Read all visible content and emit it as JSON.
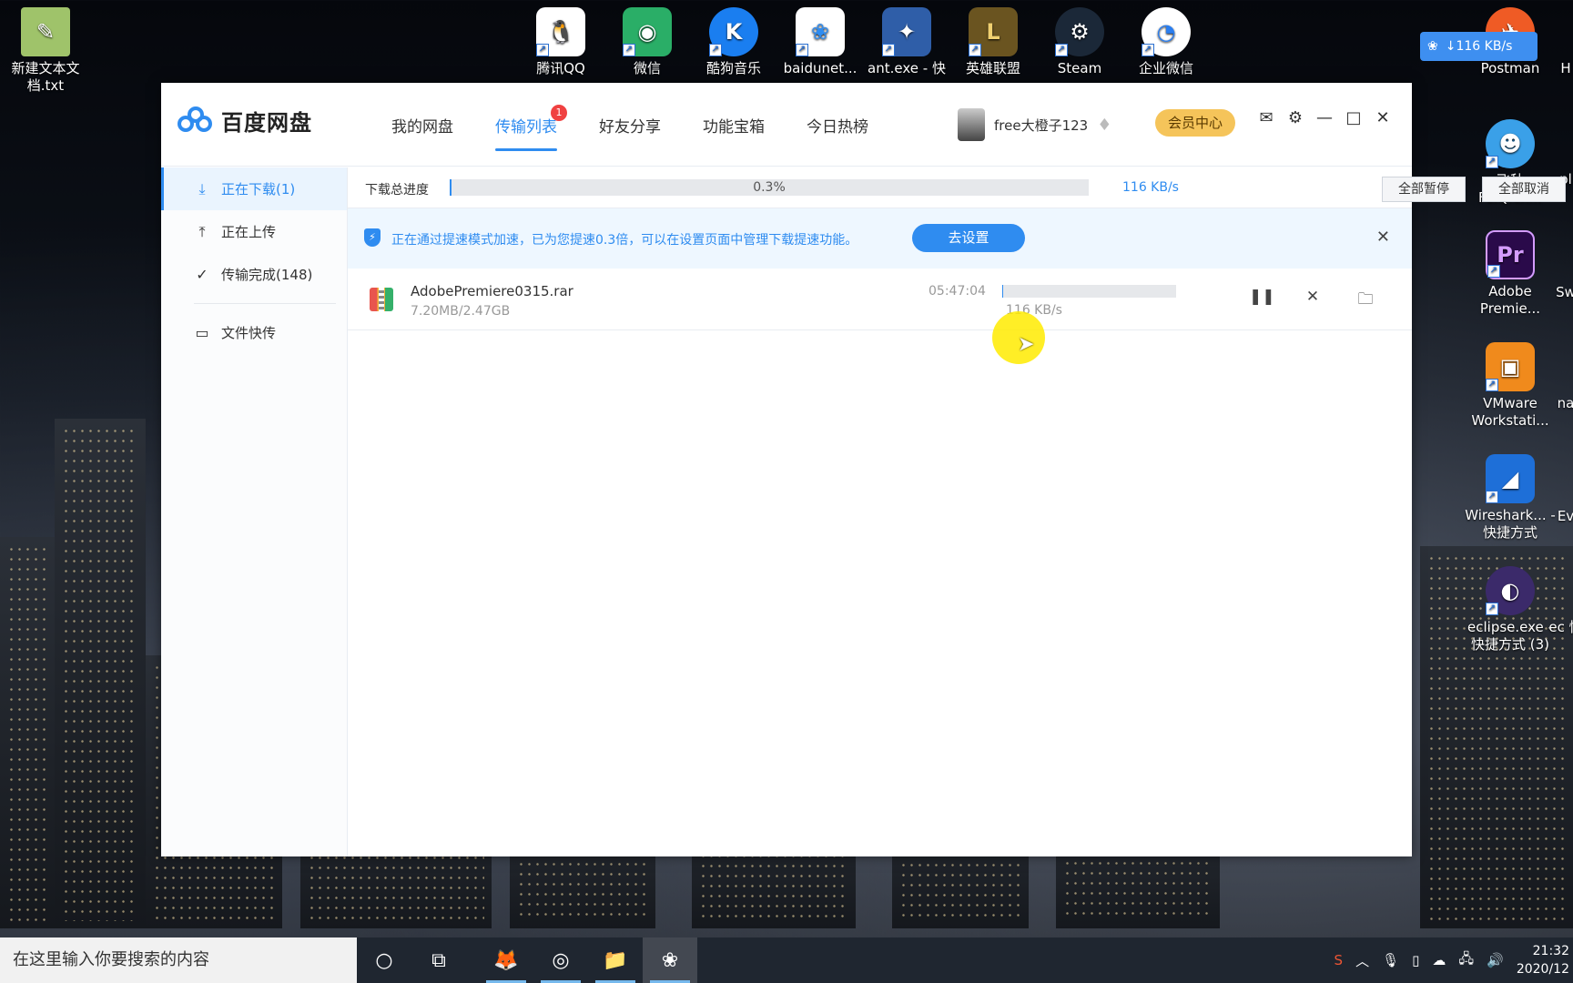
{
  "desktop": {
    "left_icons": [
      {
        "label": "新建文本文档.txt"
      }
    ],
    "top_icons": [
      {
        "label": "腾讯QQ",
        "color": "#1f1f1f"
      },
      {
        "label": "微信",
        "color": "#2aae67"
      },
      {
        "label": "酷狗音乐",
        "color": "#1a7ef0"
      },
      {
        "label": "baidunet...",
        "color": "#ffffff"
      },
      {
        "label": "ant.exe - 快",
        "color": "#2f5ea8"
      },
      {
        "label": "英雄联盟",
        "color": "#c8a24a"
      },
      {
        "label": "Steam",
        "color": "#1b2838"
      },
      {
        "label": "企业微信",
        "color": "#2a7ef0"
      }
    ],
    "right_icons": [
      {
        "label": "Postman",
        "color": "#ef5b25"
      },
      {
        "label": "飞秋 FeiQ.ex...",
        "color": "#3aa0e8"
      },
      {
        "label": "Adobe Premie...",
        "color": "#2a0a4a"
      },
      {
        "label": "VMware Workstati...",
        "color": "#6b7fa0"
      },
      {
        "label": "Wireshark... - 快捷方式",
        "color": "#1e6fd8"
      },
      {
        "label": "eclipse.exe - 快捷方式 (3)",
        "color": "#3b2a6a"
      }
    ],
    "edge_labels": [
      "H",
      "pl",
      "Sw",
      "na",
      "Ev",
      "ec 快"
    ]
  },
  "float_widget": {
    "speed": "↓116 KB/s"
  },
  "app": {
    "title": "百度网盘",
    "tabs": [
      {
        "label": "我的网盘",
        "active": false
      },
      {
        "label": "传输列表",
        "active": true,
        "badge": "1"
      },
      {
        "label": "好友分享",
        "active": false
      },
      {
        "label": "功能宝箱",
        "active": false
      },
      {
        "label": "今日热榜",
        "active": false
      }
    ],
    "username": "free大橙子123",
    "vip_label": "会员中心",
    "sidebar": [
      {
        "label": "正在下载(1)",
        "icon": "download-icon",
        "active": true
      },
      {
        "label": "正在上传",
        "icon": "upload-icon",
        "active": false
      },
      {
        "label": "传输完成(148)",
        "icon": "check-circle-icon",
        "active": false
      },
      {
        "label": "文件快传",
        "icon": "monitor-icon",
        "active": false
      }
    ],
    "total": {
      "label": "下载总进度",
      "percent_text": "0.3%",
      "progress": 0.003,
      "speed": "116 KB/s",
      "pause_all": "全部暂停",
      "cancel_all": "全部取消"
    },
    "notice": {
      "message": "正在通过提速模式加速，已为您提速0.3倍，可以在设置页面中管理下载提速功能。",
      "button": "去设置"
    },
    "downloads": [
      {
        "name": "AdobePremiere0315.rar",
        "size": "7.20MB/2.47GB",
        "time_left": "05:47:04",
        "speed": "116 KB/s",
        "progress": 0.003
      }
    ]
  },
  "taskbar": {
    "search_placeholder": "在这里输入你要搜索的内容",
    "clock_time": "21:32",
    "clock_date": "2020/12"
  },
  "colors": {
    "accent": "#2f8cf0",
    "vip": "#f5c45a",
    "badge": "#f04141"
  }
}
